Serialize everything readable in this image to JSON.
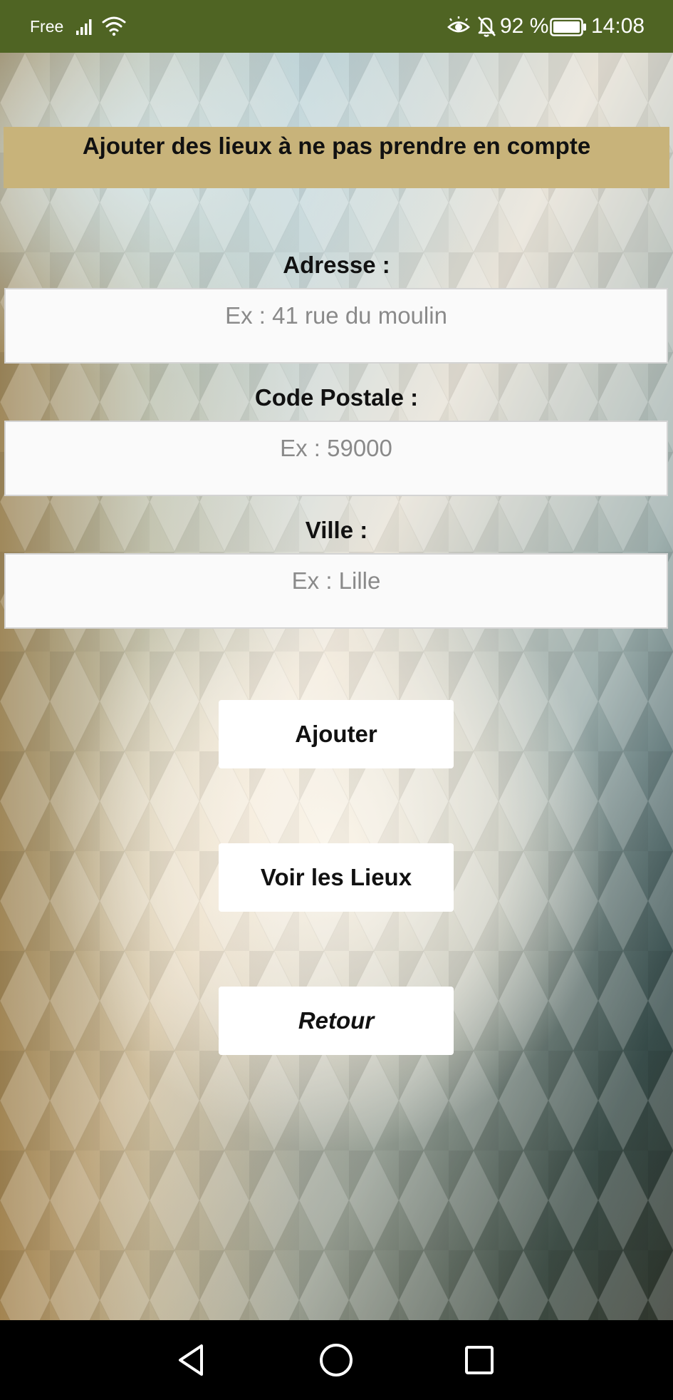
{
  "status_bar": {
    "carrier": "Free",
    "battery": "92 %",
    "time": "14:08",
    "icons": [
      "signal-icon",
      "wifi-icon",
      "eye-icon",
      "bell-off-icon",
      "battery-icon"
    ]
  },
  "header": {
    "title": "Ajouter des lieux à ne pas prendre en compte"
  },
  "form": {
    "address": {
      "label": "Adresse :",
      "placeholder": "Ex : 41 rue du moulin",
      "value": ""
    },
    "postal_code": {
      "label": "Code Postale :",
      "placeholder": "Ex : 59000",
      "value": ""
    },
    "city": {
      "label": "Ville :",
      "placeholder": "Ex : Lille",
      "value": ""
    }
  },
  "buttons": {
    "add": "Ajouter",
    "view_places": "Voir les Lieux",
    "back": "Retour"
  },
  "nav_bar": {
    "icons": [
      "back-triangle-icon",
      "home-circle-icon",
      "recents-square-icon"
    ]
  },
  "colors": {
    "status_bar": "#4f6423",
    "header_banner": "#c8b37a",
    "nav_bar": "#000000",
    "button_bg": "#ffffff"
  }
}
